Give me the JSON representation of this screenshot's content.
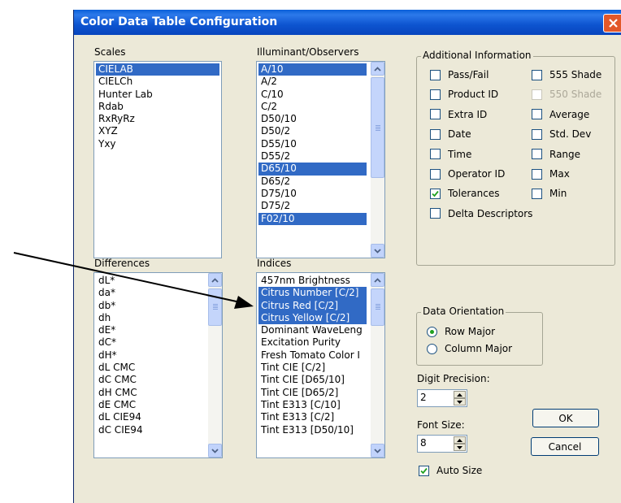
{
  "window": {
    "title": "Color Data Table Configuration"
  },
  "scales": {
    "label": "Scales",
    "items": [
      "CIELAB",
      "CIELCh",
      "Hunter Lab",
      "Rdab",
      "RxRyRz",
      "XYZ",
      "Yxy"
    ],
    "selected": [
      "CIELAB"
    ]
  },
  "illuminants": {
    "label": "Illuminant/Observers",
    "items": [
      "A/10",
      "A/2",
      "C/10",
      "C/2",
      "D50/10",
      "D50/2",
      "D55/10",
      "D55/2",
      "D65/10",
      "D65/2",
      "D75/10",
      "D75/2",
      "F02/10"
    ],
    "selected": [
      "A/10",
      "D65/10",
      "F02/10"
    ]
  },
  "differences": {
    "label": "Differences",
    "items": [
      "dL*",
      "da*",
      "db*",
      "dh",
      "dE*",
      "dC*",
      "dH*",
      "dL CMC",
      "dC CMC",
      "dH CMC",
      "dE CMC",
      "dL CIE94",
      "dC CIE94"
    ],
    "selected": []
  },
  "indices": {
    "label": "Indices",
    "items": [
      "457nm Brightness",
      "Citrus Number [C/2]",
      "Citrus Red [C/2]",
      "Citrus Yellow [C/2]",
      "Dominant WaveLeng",
      "Excitation Purity",
      "Fresh Tomato Color I",
      "Tint CIE [C/2]",
      "Tint CIE [D65/10]",
      "Tint CIE [D65/2]",
      "Tint E313 [C/10]",
      "Tint E313 [C/2]",
      "Tint E313 [D50/10]"
    ],
    "selected": [
      "Citrus Number [C/2]",
      "Citrus Red [C/2]",
      "Citrus Yellow [C/2]"
    ]
  },
  "additional_info": {
    "label": "Additional Information",
    "left": [
      {
        "label": "Pass/Fail",
        "checked": false,
        "disabled": false
      },
      {
        "label": "Product ID",
        "checked": false,
        "disabled": false
      },
      {
        "label": "Extra ID",
        "checked": false,
        "disabled": false
      },
      {
        "label": "Date",
        "checked": false,
        "disabled": false
      },
      {
        "label": "Time",
        "checked": false,
        "disabled": false
      },
      {
        "label": "Operator ID",
        "checked": false,
        "disabled": false
      },
      {
        "label": "Tolerances",
        "checked": true,
        "disabled": false
      },
      {
        "label": "Delta Descriptors",
        "checked": false,
        "disabled": false
      }
    ],
    "right": [
      {
        "label": "555 Shade",
        "checked": false,
        "disabled": false
      },
      {
        "label": "550 Shade",
        "checked": false,
        "disabled": true
      },
      {
        "label": "Average",
        "checked": false,
        "disabled": false
      },
      {
        "label": "Std. Dev",
        "checked": false,
        "disabled": false
      },
      {
        "label": "Range",
        "checked": false,
        "disabled": false
      },
      {
        "label": "Max",
        "checked": false,
        "disabled": false
      },
      {
        "label": "Min",
        "checked": false,
        "disabled": false
      }
    ]
  },
  "orientation": {
    "label": "Data Orientation",
    "options": [
      "Row Major",
      "Column Major"
    ],
    "selected": "Row Major"
  },
  "precision": {
    "label": "Digit Precision:",
    "value": "2"
  },
  "font_size": {
    "label": "Font Size:",
    "value": "8"
  },
  "auto_size": {
    "label": "Auto Size",
    "checked": true
  },
  "buttons": {
    "ok": "OK",
    "cancel": "Cancel"
  },
  "colors": {
    "selection": "#316ac5",
    "titlebar": "#0a5fd9",
    "dialog_bg": "#ece9d8"
  }
}
